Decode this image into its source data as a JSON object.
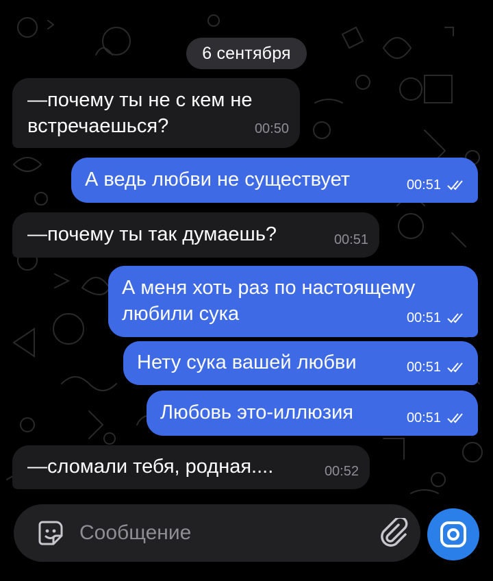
{
  "chat": {
    "date_separator": "6 сентября",
    "messages": [
      {
        "direction": "incoming",
        "lines": [
          "—почему ты не с кем не",
          "встречаешься?"
        ],
        "time": "00:50"
      },
      {
        "direction": "outgoing",
        "lines": [
          "А ведь любви не существует"
        ],
        "time": "00:51",
        "status": "read"
      },
      {
        "direction": "incoming",
        "lines": [
          "—почему ты так думаешь?"
        ],
        "time": "00:51"
      },
      {
        "direction": "outgoing",
        "lines": [
          "А меня хоть раз по настоящему",
          "любили сука"
        ],
        "time": "00:51",
        "status": "read"
      },
      {
        "direction": "outgoing",
        "lines": [
          "Нету сука вашей любви"
        ],
        "time": "00:51",
        "status": "read"
      },
      {
        "direction": "outgoing",
        "lines": [
          "Любовь это-иллюзия"
        ],
        "time": "00:51",
        "status": "read"
      },
      {
        "direction": "incoming",
        "lines": [
          "—сломали тебя, родная...."
        ],
        "time": "00:52"
      }
    ]
  },
  "composer": {
    "placeholder": "Сообщение",
    "left_icon": "sticker-icon",
    "attach_icon": "paperclip-icon",
    "send_icon": "camera-icon"
  },
  "colors": {
    "background": "#000000",
    "incoming_bubble": "#1c1c1e",
    "outgoing_bubble": "#3e6ae5",
    "accent": "#2b7fe9"
  }
}
